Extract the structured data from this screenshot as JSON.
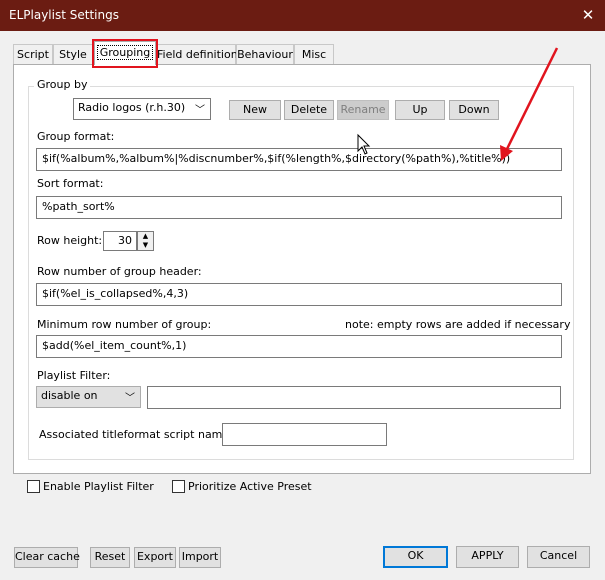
{
  "window": {
    "title": "ELPlaylist Settings"
  },
  "tabs": [
    "Script",
    "Style",
    "Grouping",
    "Field definition",
    "Behaviour",
    "Misc"
  ],
  "group_by": {
    "legend": "Group by",
    "preset": "Radio logos (r.h.30)",
    "buttons": {
      "new": "New",
      "delete": "Delete",
      "rename": "Rename",
      "up": "Up",
      "down": "Down"
    }
  },
  "group_format": {
    "label": "Group format:",
    "value": "$if(%album%,%album%|%discnumber%,$if(%length%,$directory(%path%),%title%))"
  },
  "sort_format": {
    "label": "Sort format:",
    "value": "%path_sort%"
  },
  "row_height": {
    "label": "Row height:",
    "value": "30"
  },
  "row_number_header": {
    "label": "Row number of group header:",
    "value": "$if(%el_is_collapsed%,4,3)"
  },
  "min_row_number": {
    "label": "Minimum row number of group:",
    "note": "note: empty rows are added if necessary",
    "value": "$add(%el_item_count%,1)"
  },
  "playlist_filter": {
    "label": "Playlist Filter:",
    "mode": "disable on",
    "value": ""
  },
  "titleformat": {
    "label": "Associated titleformat script name:",
    "value": ""
  },
  "options": {
    "enable_filter": "Enable Playlist Filter",
    "prioritize_preset": "Prioritize Active Preset"
  },
  "footer": {
    "clear_cache": "Clear cache",
    "reset": "Reset",
    "export": "Export",
    "import": "Import",
    "ok": "OK",
    "apply": "APPLY",
    "cancel": "Cancel"
  },
  "colors": {
    "titlebar": "#6b1c12",
    "annotation": "#e1141e",
    "accent": "#0078d7"
  },
  "icons": {
    "close": "close-icon",
    "dropdown": "chevron-down-icon",
    "spin": "spin-arrows-icon",
    "cursor": "mouse-pointer-icon"
  }
}
